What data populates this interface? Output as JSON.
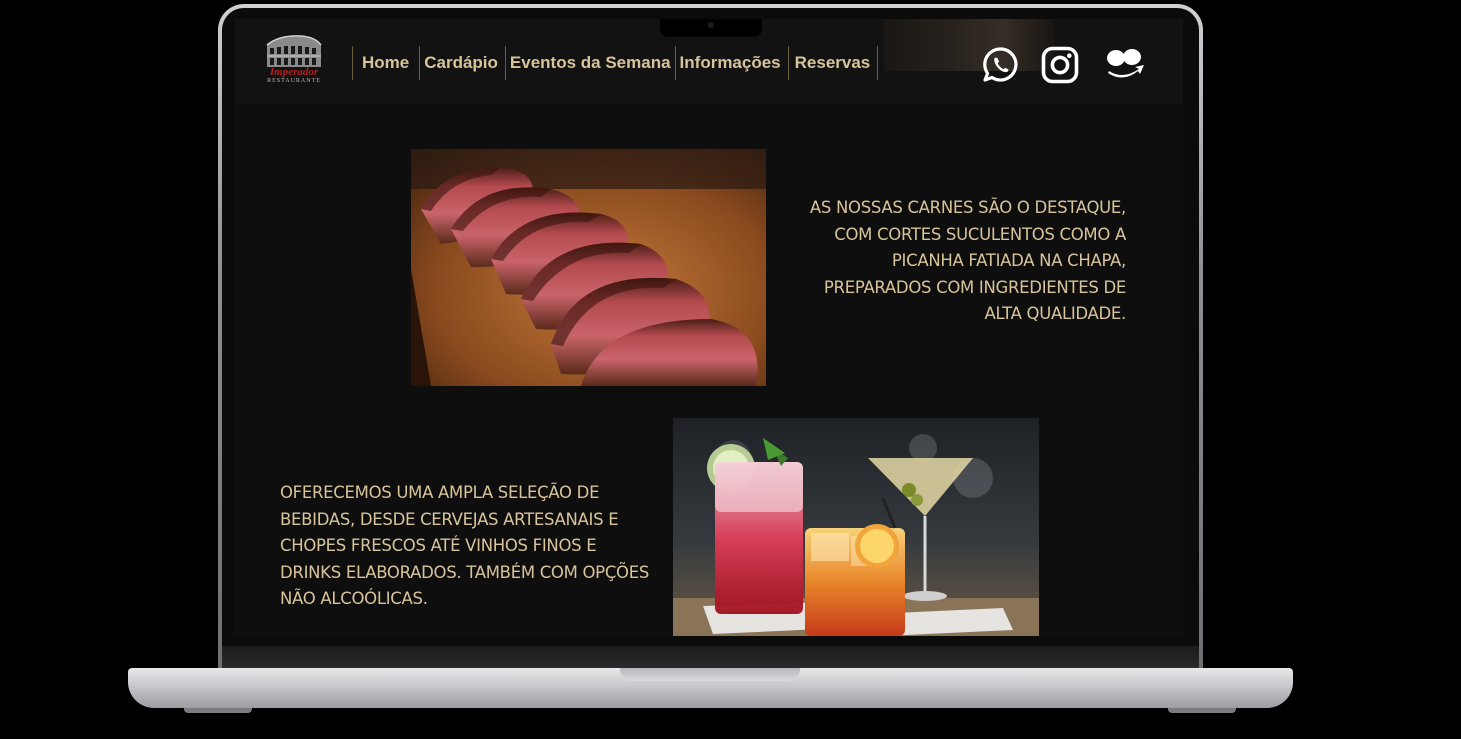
{
  "site": {
    "logo": {
      "name": "Imperador",
      "subtitle": "RESTAURANTE"
    },
    "nav": [
      {
        "label": "Home"
      },
      {
        "label": "Cardápio"
      },
      {
        "label": "Eventos da Semana"
      },
      {
        "label": "Informações"
      },
      {
        "label": "Reservas"
      }
    ],
    "social": [
      "whatsapp-icon",
      "instagram-icon",
      "ifood-icon"
    ],
    "colors": {
      "accent": "#d8c49a",
      "background": "#0e0e0e",
      "brand_red": "#b21f1f"
    }
  },
  "sections": {
    "meat": {
      "text": "As nossas carnes são o destaque, com cortes suculentos como a picanha fatiada na chapa, preparados com ingredientes de alta qualidade."
    },
    "drinks": {
      "text": "Oferecemos uma ampla seleção de bebidas, desde cervejas artesanais e chopes frescos até vinhos finos e drinks elaborados. Também com opções não alcoólicas."
    }
  }
}
